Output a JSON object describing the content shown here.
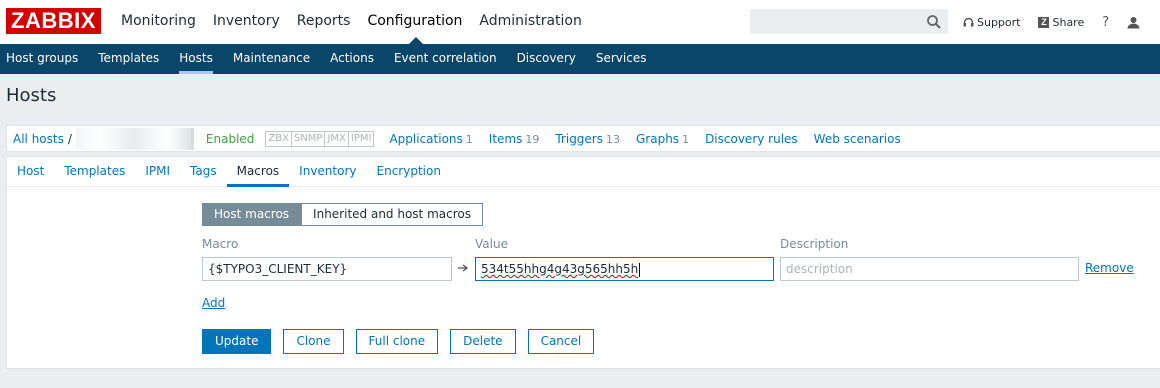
{
  "brand": {
    "logo_text": "ZABBIX",
    "color": "#d40000"
  },
  "topnav": {
    "items": [
      {
        "label": "Monitoring"
      },
      {
        "label": "Inventory"
      },
      {
        "label": "Reports"
      },
      {
        "label": "Configuration",
        "active": true
      },
      {
        "label": "Administration"
      }
    ]
  },
  "search": {
    "value": "",
    "icon": "search-icon"
  },
  "toplinks": {
    "support": "Support",
    "share": "Share",
    "help": "?",
    "user_icon": "user-icon"
  },
  "subnav": {
    "items": [
      {
        "label": "Host groups"
      },
      {
        "label": "Templates"
      },
      {
        "label": "Hosts",
        "active": true
      },
      {
        "label": "Maintenance"
      },
      {
        "label": "Actions"
      },
      {
        "label": "Event correlation"
      },
      {
        "label": "Discovery"
      },
      {
        "label": "Services"
      }
    ]
  },
  "page": {
    "title": "Hosts"
  },
  "hostbar": {
    "all_hosts": "All hosts",
    "separator": "/",
    "status": "Enabled",
    "availability": [
      "ZBX",
      "SNMP",
      "JMX",
      "IPMI"
    ],
    "links": [
      {
        "label": "Applications",
        "count": "1"
      },
      {
        "label": "Items",
        "count": "19"
      },
      {
        "label": "Triggers",
        "count": "13"
      },
      {
        "label": "Graphs",
        "count": "1"
      },
      {
        "label": "Discovery rules",
        "count": ""
      },
      {
        "label": "Web scenarios",
        "count": ""
      }
    ]
  },
  "tabs": [
    {
      "label": "Host"
    },
    {
      "label": "Templates"
    },
    {
      "label": "IPMI"
    },
    {
      "label": "Tags"
    },
    {
      "label": "Macros",
      "active": true
    },
    {
      "label": "Inventory"
    },
    {
      "label": "Encryption"
    }
  ],
  "macro_mode": {
    "host_macros": "Host macros",
    "inherited": "Inherited and host macros"
  },
  "macros_table": {
    "headers": {
      "macro": "Macro",
      "value": "Value",
      "description": "Description"
    },
    "rows": [
      {
        "macro": "{$TYPO3_CLIENT_KEY}",
        "value": "534t55hhg4g43g565hh5h",
        "description_placeholder": "description",
        "remove": "Remove"
      }
    ],
    "add": "Add"
  },
  "buttons": {
    "update": "Update",
    "clone": "Clone",
    "full_clone": "Full clone",
    "delete": "Delete",
    "cancel": "Cancel"
  },
  "colors": {
    "nav_bg": "#0a466a",
    "link": "#0275b8",
    "enabled": "#429e47",
    "page_bg": "#ebeef0"
  }
}
